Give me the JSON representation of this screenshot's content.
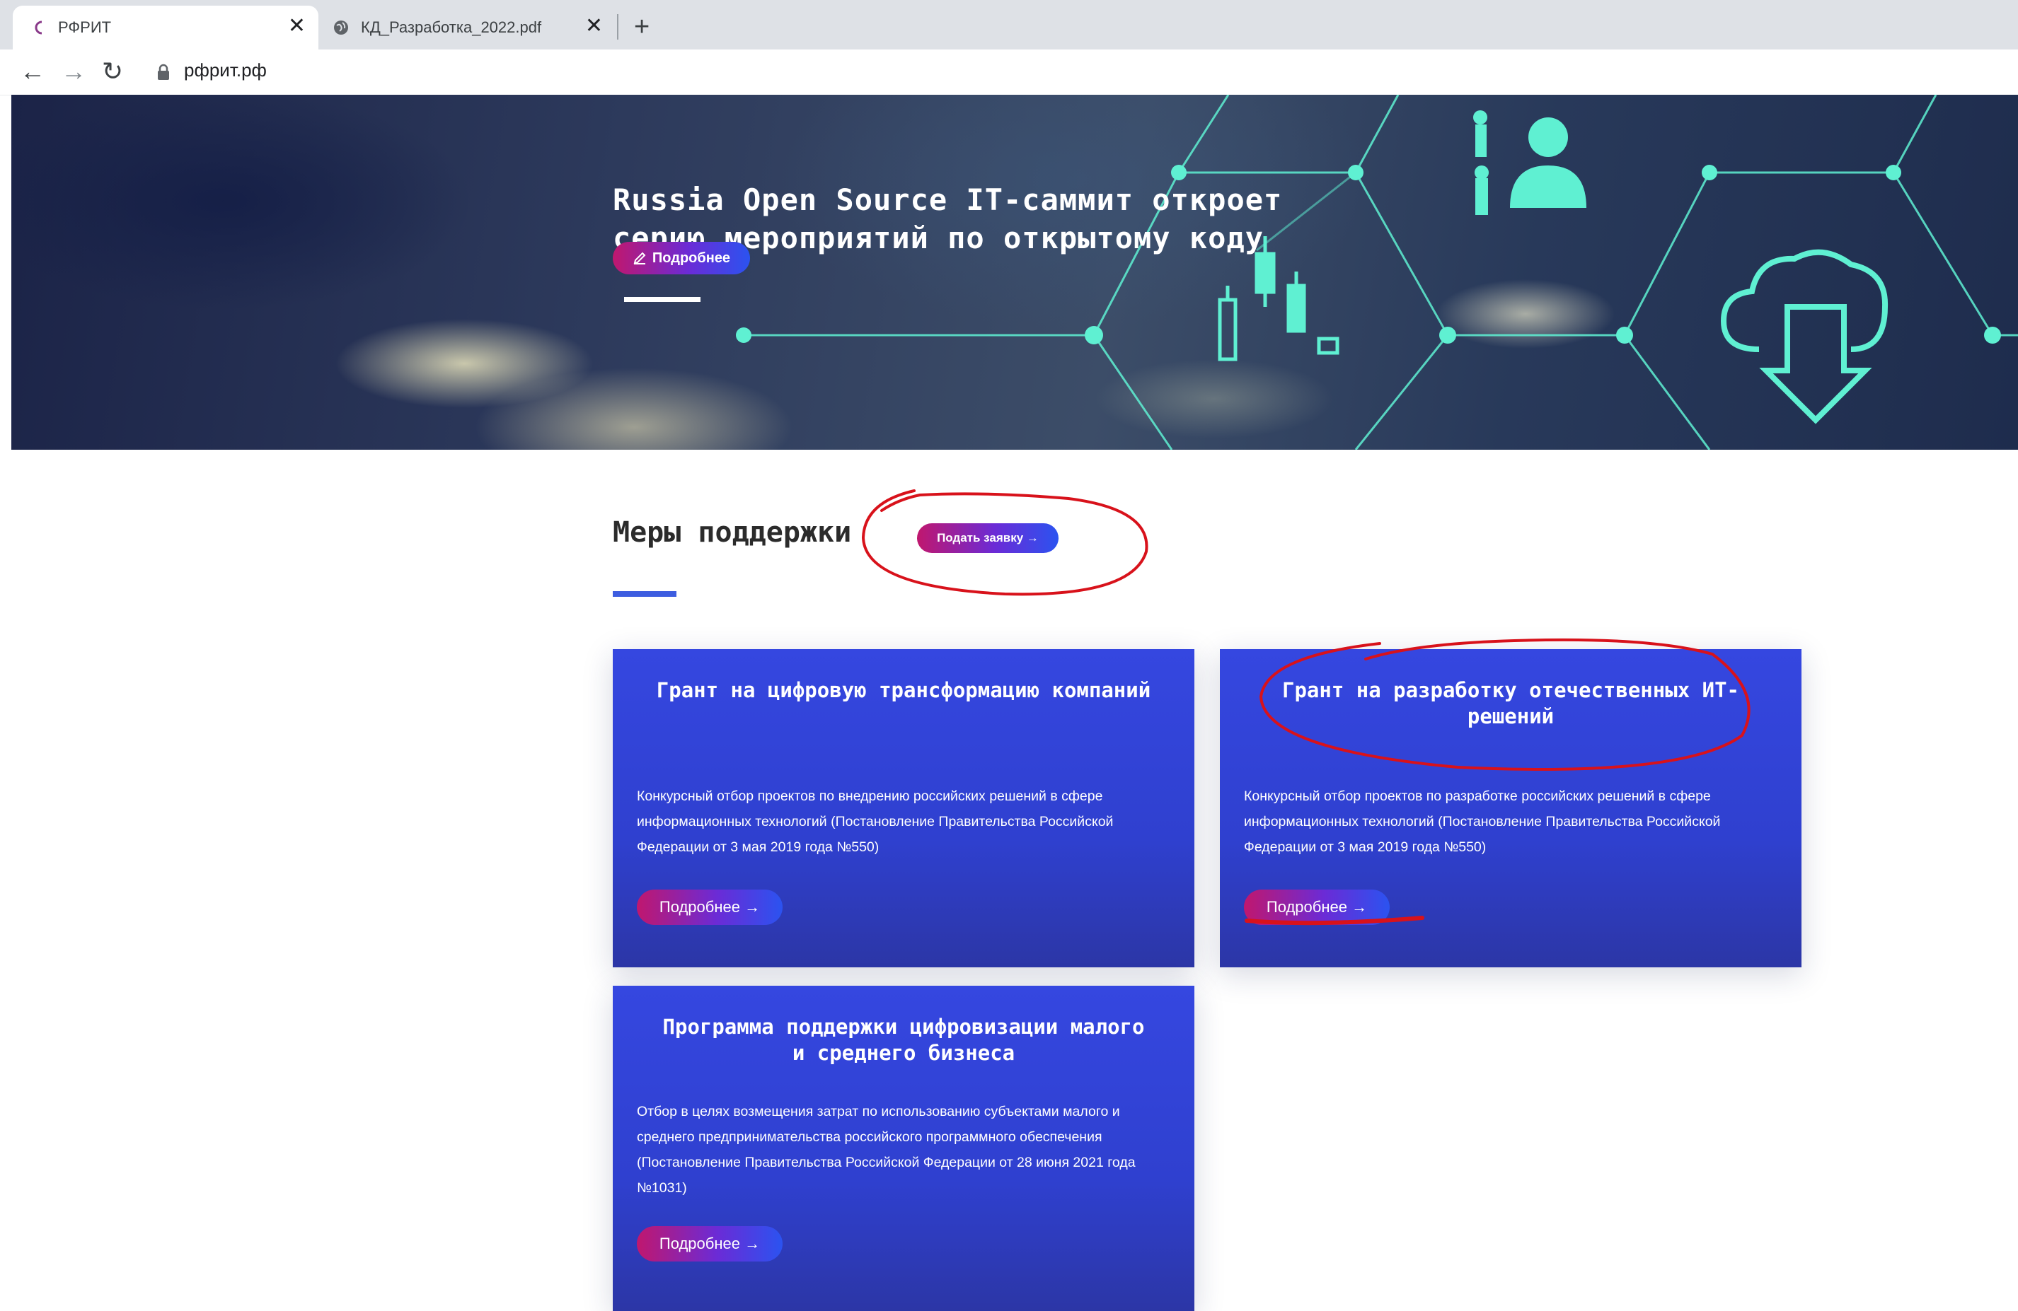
{
  "browser": {
    "tabs": [
      {
        "title": "РФРИТ",
        "active": true,
        "icon": "rfrit-logo-icon"
      },
      {
        "title": "КД_Разработка_2022.pdf",
        "active": false,
        "icon": "globe-icon"
      }
    ],
    "close_glyph": "✕",
    "new_tab_glyph": "+",
    "back_glyph": "←",
    "forward_glyph": "→",
    "reload_glyph": "↻",
    "url": "рфрит.рф"
  },
  "hero": {
    "title_line1": "Russia Open Source IT-саммит откроет",
    "title_line2": "серию мероприятий по открытому коду",
    "button_label": "Подробнее",
    "button_icon": "pencil-icon"
  },
  "support": {
    "title": "Меры поддержки",
    "apply_label": "Подать заявку →",
    "cards": [
      {
        "title": "Грант на цифровую трансформацию компаний",
        "description": "Конкурсный отбор проектов по внедрению российских решений в сфере информационных технологий (Постановление Правительства Российской Федерации от 3 мая 2019 года №550)",
        "button": "Подробнее →"
      },
      {
        "title": "Грант на разработку отечественных ИТ-решений",
        "description": "Конкурсный отбор проектов по разработке российских решений в сфере информационных технологий (Постановление Правительства Российской Федерации от 3 мая 2019 года №550)",
        "button": "Подробнее →"
      },
      {
        "title": "Программа поддержки цифровизации малого и среднего бизнеса",
        "description": "Отбор в целях возмещения затрат по использованию субъектами малого и среднего предпринимательства российского программного обеспечения (Постановление Правительства Российской Федерации от 28 июня 2021 года №1031)",
        "button": "Подробнее →"
      }
    ]
  },
  "colors": {
    "accent_blue": "#3d5de0",
    "card_blue": "#3547e0",
    "button_magenta": "#c0176e",
    "annotation_red": "#d8121b"
  }
}
